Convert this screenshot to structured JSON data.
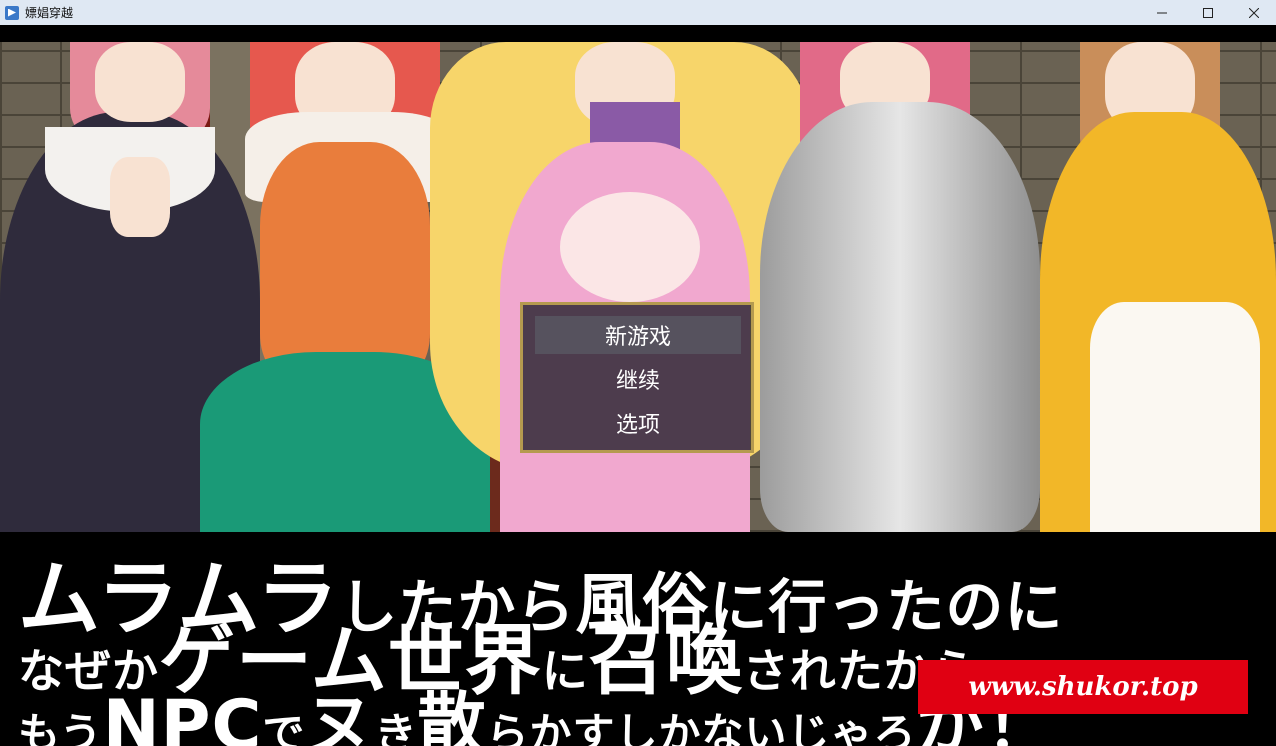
{
  "window": {
    "title": "嫖娼穿越",
    "minimize_icon": "minimize-icon",
    "maximize_icon": "maximize-icon",
    "close_icon": "close-icon"
  },
  "menu": {
    "items": [
      {
        "label": "新游戏",
        "selected": true
      },
      {
        "label": "继续",
        "selected": false
      },
      {
        "label": "选项",
        "selected": false
      }
    ]
  },
  "caption": {
    "line1": {
      "big": "ムラムラ",
      "small": "したから",
      "big2": "風俗",
      "small2": "に行ったのに"
    },
    "line2": {
      "small": "なぜか",
      "big": "ゲーム世界",
      "small2": "に",
      "big2": "召喚",
      "small3": "されたから、"
    },
    "line3": {
      "small": "もう",
      "big": "NPC",
      "small2": "で",
      "big2": "ヌ",
      "small3": "き",
      "big3": "散",
      "small4": "らかすしかないじゃろ",
      "big4": "が！"
    }
  },
  "watermark": "www.shukor.top",
  "colors": {
    "menu_border": "#b59a4f",
    "watermark_bg": "#e00012",
    "titlebar_bg": "#dfe8f3"
  }
}
